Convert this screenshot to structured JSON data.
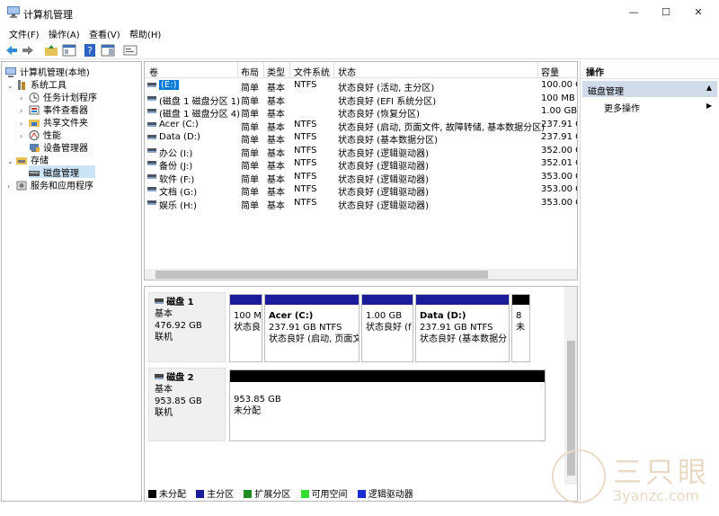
{
  "window": {
    "title": "计算机管理",
    "min": "—",
    "max": "☐",
    "close": "✕"
  },
  "menu": [
    "文件(F)",
    "操作(A)",
    "查看(V)",
    "帮助(H)"
  ],
  "tree": {
    "root": "计算机管理(本地)",
    "system_tools": "系统工具",
    "task_scheduler": "任务计划程序",
    "event_viewer": "事件查看器",
    "shared_folders": "共享文件夹",
    "performance": "性能",
    "device_manager": "设备管理器",
    "storage": "存储",
    "disk_management": "磁盘管理",
    "services": "服务和应用程序"
  },
  "volume_table": {
    "headers": [
      "卷",
      "布局",
      "类型",
      "文件系统",
      "状态",
      "容量"
    ],
    "rows": [
      {
        "vol": "(E:)",
        "layout": "简单",
        "type": "基本",
        "fs": "NTFS",
        "status": "状态良好 (活动, 主分区)",
        "cap": "100.00 G"
      },
      {
        "vol": "(磁盘 1 磁盘分区 1)",
        "layout": "简单",
        "type": "基本",
        "fs": "",
        "status": "状态良好 (EFI 系统分区)",
        "cap": "100 MB"
      },
      {
        "vol": "(磁盘 1 磁盘分区 4)",
        "layout": "简单",
        "type": "基本",
        "fs": "",
        "status": "状态良好 (恢复分区)",
        "cap": "1.00 GB"
      },
      {
        "vol": "Acer (C:)",
        "layout": "简单",
        "type": "基本",
        "fs": "NTFS",
        "status": "状态良好 (启动, 页面文件, 故障转储, 基本数据分区)",
        "cap": "237.91 G"
      },
      {
        "vol": "Data (D:)",
        "layout": "简单",
        "type": "基本",
        "fs": "NTFS",
        "status": "状态良好 (基本数据分区)",
        "cap": "237.91 G"
      },
      {
        "vol": "办公 (I:)",
        "layout": "简单",
        "type": "基本",
        "fs": "NTFS",
        "status": "状态良好 (逻辑驱动器)",
        "cap": "352.00 G"
      },
      {
        "vol": "备份 (J:)",
        "layout": "简单",
        "type": "基本",
        "fs": "NTFS",
        "status": "状态良好 (逻辑驱动器)",
        "cap": "352.01 G"
      },
      {
        "vol": "软件 (F:)",
        "layout": "简单",
        "type": "基本",
        "fs": "NTFS",
        "status": "状态良好 (逻辑驱动器)",
        "cap": "353.00 G"
      },
      {
        "vol": "文档 (G:)",
        "layout": "简单",
        "type": "基本",
        "fs": "NTFS",
        "status": "状态良好 (逻辑驱动器)",
        "cap": "353.00 G"
      },
      {
        "vol": "娱乐 (H:)",
        "layout": "简单",
        "type": "基本",
        "fs": "NTFS",
        "status": "状态良好 (逻辑驱动器)",
        "cap": "353.00 G"
      }
    ]
  },
  "disk1": {
    "name": "磁盘 1",
    "type": "基本",
    "size": "476.92 GB",
    "state": "联机",
    "p1": {
      "l1": "100 M",
      "l2": "状态良"
    },
    "p2": {
      "l1": "Acer  (C:)",
      "l2": "237.91 GB NTFS",
      "l3": "状态良好 (启动, 页面文"
    },
    "p3": {
      "l1": "1.00 GB",
      "l2": "状态良好 (f"
    },
    "p4": {
      "l1": "Data  (D:)",
      "l2": "237.91 GB NTFS",
      "l3": "状态良好 (基本数据分"
    },
    "p5": {
      "l1": "8",
      "l2": "未"
    }
  },
  "disk2": {
    "name": "磁盘 2",
    "type": "基本",
    "size": "953.85 GB",
    "state": "联机",
    "p1": {
      "l1": "953.85 GB",
      "l2": "未分配"
    }
  },
  "legend": [
    {
      "label": "未分配",
      "color": "#000000"
    },
    {
      "label": "主分区",
      "color": "#1c1c9a"
    },
    {
      "label": "扩展分区",
      "color": "#1e8c1e"
    },
    {
      "label": "可用空间",
      "color": "#33dd33"
    },
    {
      "label": "逻辑驱动器",
      "color": "#1a2dd4"
    }
  ],
  "actions": {
    "header": "操作",
    "section": "磁盘管理",
    "more": "更多操作"
  },
  "watermark": {
    "cn": "三只眼",
    "url": "3yanzc.com"
  }
}
